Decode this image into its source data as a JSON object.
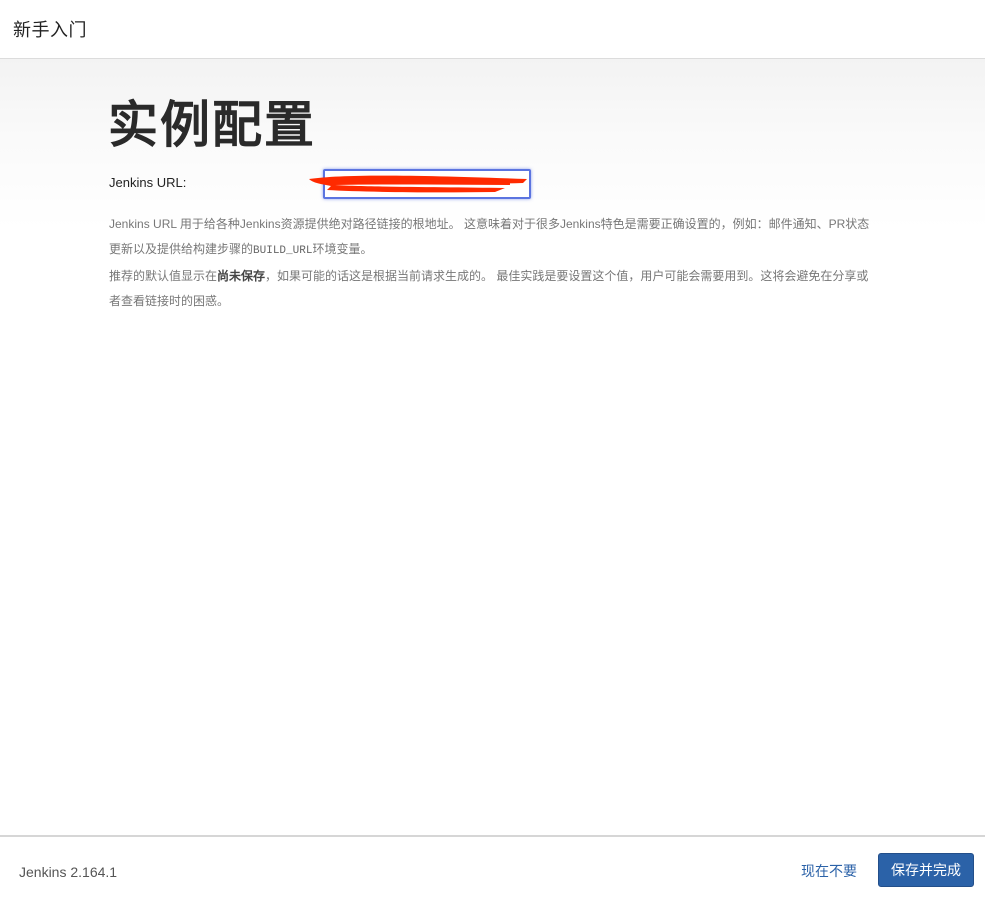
{
  "header": {
    "title": "新手入门"
  },
  "main": {
    "page_title": "实例配置",
    "url_field": {
      "label": "Jenkins URL:",
      "value": ""
    },
    "help": {
      "p1_text": "Jenkins URL 用于给各种Jenkins资源提供绝对路径链接的根地址。 这意味着对于很多Jenkins特色是需要正确设置的，例如：邮件通知、PR状态更新以及提供给构建步骤的",
      "p1_code": "BUILD_URL",
      "p1_tail": "环境变量。",
      "p2_lead": "推荐的默认值显示在",
      "p2_emphasis": "尚未保存",
      "p2_tail": "，如果可能的话这是根据当前请求生成的。 最佳实践是要设置这个值，用户可能会需要用到。这将会避免在分享或者查看链接时的困惑。"
    }
  },
  "footer": {
    "version": "Jenkins 2.164.1",
    "skip_label": "现在不要",
    "finish_label": "保存并完成"
  },
  "colors": {
    "primary": "#2b62a8",
    "input_focus": "#5b74e0",
    "redaction": "#ff2a00"
  }
}
